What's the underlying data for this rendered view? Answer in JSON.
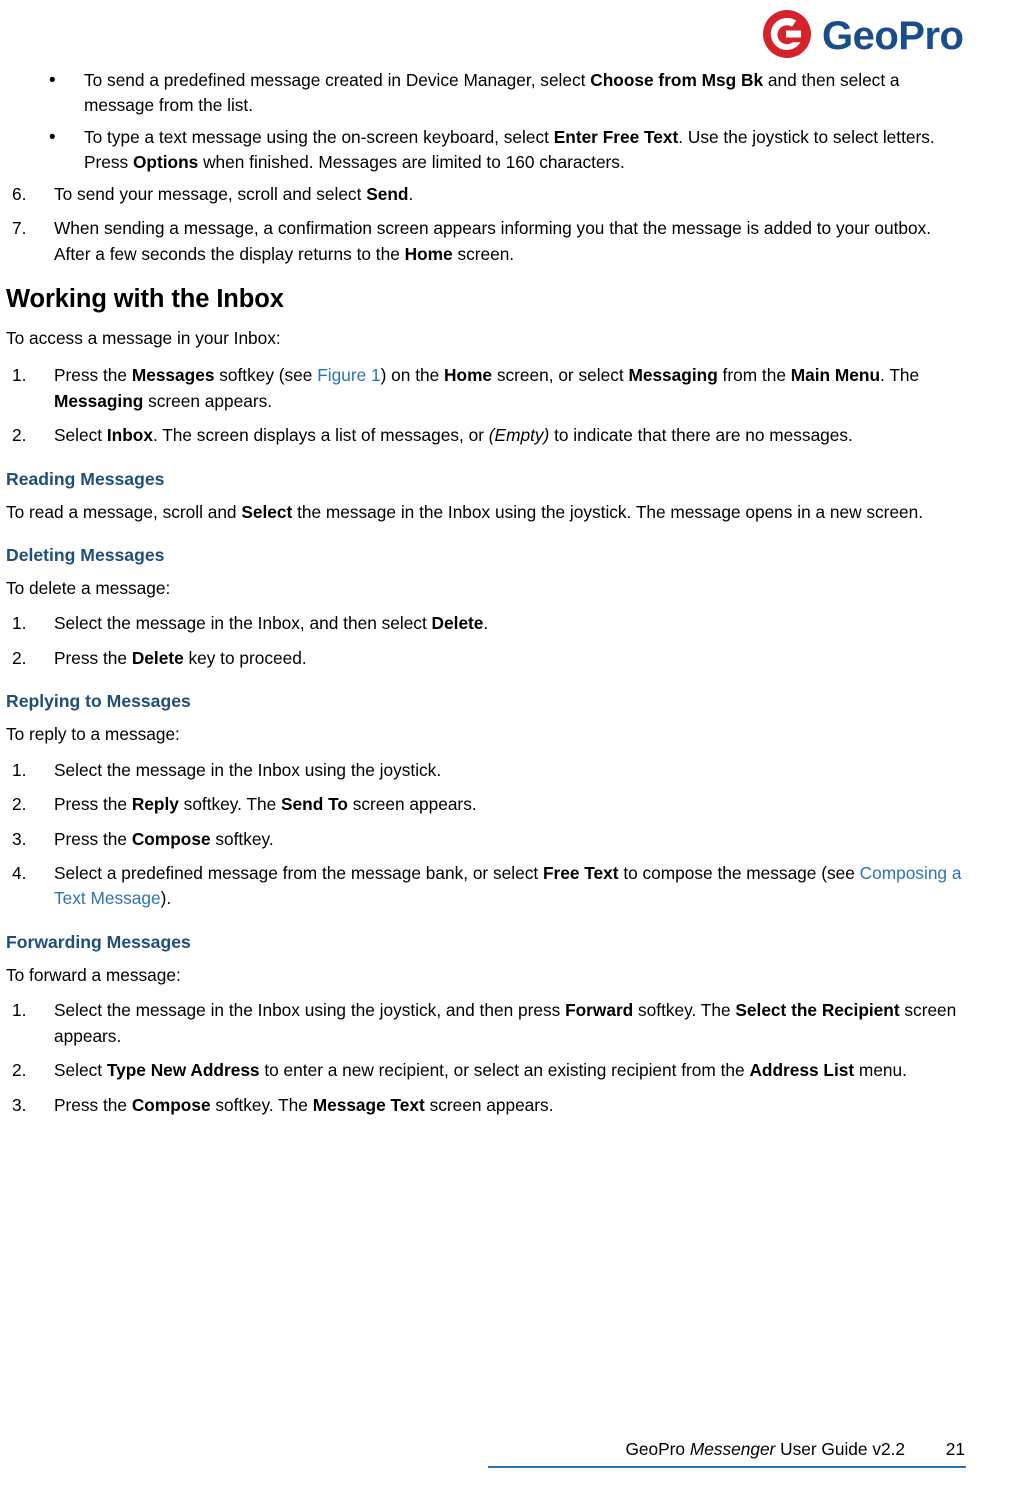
{
  "header": {
    "logo_text": "GeoPro",
    "logo_mark": "geopro-logo",
    "logo_color": "#D6222A",
    "logo_text_color": "#1A4E8A"
  },
  "content": {
    "top_bullets": [
      {
        "parts": [
          {
            "t": "To send a predefined message created in Device Manager, select ",
            "s": "normal"
          },
          {
            "t": "Choose from Msg Bk",
            "s": "bold"
          },
          {
            "t": " and then select a message from the list.",
            "s": "normal"
          }
        ]
      },
      {
        "parts": [
          {
            "t": "To type a text message using the on-screen keyboard, select ",
            "s": "normal"
          },
          {
            "t": "Enter Free Text",
            "s": "bold"
          },
          {
            "t": ". Use the joystick to select letters. Press ",
            "s": "normal"
          },
          {
            "t": "Options",
            "s": "bold"
          },
          {
            "t": " when finished. Messages are limited to 160 characters.",
            "s": "normal"
          }
        ]
      }
    ],
    "top_numbered": [
      {
        "num": "6.",
        "parts": [
          {
            "t": "To send your message, scroll and select ",
            "s": "normal"
          },
          {
            "t": "Send",
            "s": "bold"
          },
          {
            "t": ".",
            "s": "normal"
          }
        ]
      },
      {
        "num": "7.",
        "parts": [
          {
            "t": "When sending a message, a confirmation screen appears informing you that the message is added to your outbox. After a few seconds the display returns to the ",
            "s": "normal"
          },
          {
            "t": "Home",
            "s": "bold"
          },
          {
            "t": " screen.",
            "s": "normal"
          }
        ]
      }
    ],
    "heading_inbox": "Working with the Inbox",
    "inbox_lead": "To access a message in your Inbox:",
    "inbox_steps": [
      {
        "num": "1.",
        "parts": [
          {
            "t": "Press the ",
            "s": "normal"
          },
          {
            "t": "Messages",
            "s": "bold"
          },
          {
            "t": " softkey (see ",
            "s": "normal"
          },
          {
            "t": "Figure 1",
            "s": "link"
          },
          {
            "t": ") on the ",
            "s": "normal"
          },
          {
            "t": "Home",
            "s": "bold"
          },
          {
            "t": " screen, or select ",
            "s": "normal"
          },
          {
            "t": "Messaging",
            "s": "bold"
          },
          {
            "t": " from the ",
            "s": "normal"
          },
          {
            "t": "Main Menu",
            "s": "bold"
          },
          {
            "t": ". The ",
            "s": "normal"
          },
          {
            "t": "Messaging",
            "s": "bold"
          },
          {
            "t": " screen appears.",
            "s": "normal"
          }
        ]
      },
      {
        "num": "2.",
        "parts": [
          {
            "t": "Select ",
            "s": "normal"
          },
          {
            "t": "Inbox",
            "s": "bold"
          },
          {
            "t": ". The screen displays a list of messages, or ",
            "s": "normal"
          },
          {
            "t": "(Empty)",
            "s": "italic"
          },
          {
            "t": " to indicate that there are no messages.",
            "s": "normal"
          }
        ]
      }
    ],
    "reading": {
      "heading": "Reading Messages",
      "parts": [
        {
          "t": "To read a message, scroll and ",
          "s": "normal"
        },
        {
          "t": "Select",
          "s": "bold"
        },
        {
          "t": " the message in the Inbox using the joystick. The message opens in a new screen.",
          "s": "normal"
        }
      ]
    },
    "deleting": {
      "heading": "Deleting Messages",
      "lead": "To delete a message:",
      "steps": [
        {
          "num": "1.",
          "parts": [
            {
              "t": "Select the message in the Inbox, and then select ",
              "s": "normal"
            },
            {
              "t": "Delete",
              "s": "bold"
            },
            {
              "t": ".",
              "s": "normal"
            }
          ]
        },
        {
          "num": "2.",
          "parts": [
            {
              "t": "Press the ",
              "s": "normal"
            },
            {
              "t": "Delete",
              "s": "bold"
            },
            {
              "t": " key to proceed.",
              "s": "normal"
            }
          ]
        }
      ]
    },
    "replying": {
      "heading": "Replying to Messages",
      "lead": "To reply to a message:",
      "steps": [
        {
          "num": "1.",
          "parts": [
            {
              "t": "Select the message in the Inbox using the joystick.",
              "s": "normal"
            }
          ]
        },
        {
          "num": "2.",
          "parts": [
            {
              "t": "Press the ",
              "s": "normal"
            },
            {
              "t": "Reply",
              "s": "bold"
            },
            {
              "t": " softkey. The ",
              "s": "normal"
            },
            {
              "t": "Send To",
              "s": "bold"
            },
            {
              "t": " screen appears.",
              "s": "normal"
            }
          ]
        },
        {
          "num": "3.",
          "parts": [
            {
              "t": "Press the ",
              "s": "normal"
            },
            {
              "t": "Compose",
              "s": "bold"
            },
            {
              "t": " softkey.",
              "s": "normal"
            }
          ]
        },
        {
          "num": "4.",
          "parts": [
            {
              "t": "Select a predefined message from the message bank, or select ",
              "s": "normal"
            },
            {
              "t": "Free Text",
              "s": "bold"
            },
            {
              "t": " to compose the message (see ",
              "s": "normal"
            },
            {
              "t": "Composing a Text Message",
              "s": "link"
            },
            {
              "t": ").",
              "s": "normal"
            }
          ]
        }
      ]
    },
    "forwarding": {
      "heading": "Forwarding Messages",
      "lead": "To forward a message:",
      "steps": [
        {
          "num": "1.",
          "parts": [
            {
              "t": "Select the message in the Inbox using the joystick, and then press ",
              "s": "normal"
            },
            {
              "t": "Forward",
              "s": "bold"
            },
            {
              "t": " softkey. The ",
              "s": "normal"
            },
            {
              "t": "Select the Recipient",
              "s": "bold"
            },
            {
              "t": " screen appears.",
              "s": "normal"
            }
          ]
        },
        {
          "num": "2.",
          "parts": [
            {
              "t": "Select ",
              "s": "normal"
            },
            {
              "t": "Type New Address",
              "s": "bold"
            },
            {
              "t": " to enter a new recipient, or select an existing recipient from the ",
              "s": "normal"
            },
            {
              "t": "Address List",
              "s": "bold"
            },
            {
              "t": " menu.",
              "s": "normal"
            }
          ]
        },
        {
          "num": "3.",
          "parts": [
            {
              "t": "Press the ",
              "s": "normal"
            },
            {
              "t": "Compose",
              "s": "bold"
            },
            {
              "t": " softkey. The ",
              "s": "normal"
            },
            {
              "t": "Message Text",
              "s": "bold"
            },
            {
              "t": " screen appears.",
              "s": "normal"
            }
          ]
        }
      ]
    }
  },
  "footer": {
    "text_plain_1": "GeoPro ",
    "text_italic": "Messenger",
    "text_plain_2": " User Guide v2.2",
    "page_number": "21",
    "rule_color": "#2E74B5"
  }
}
